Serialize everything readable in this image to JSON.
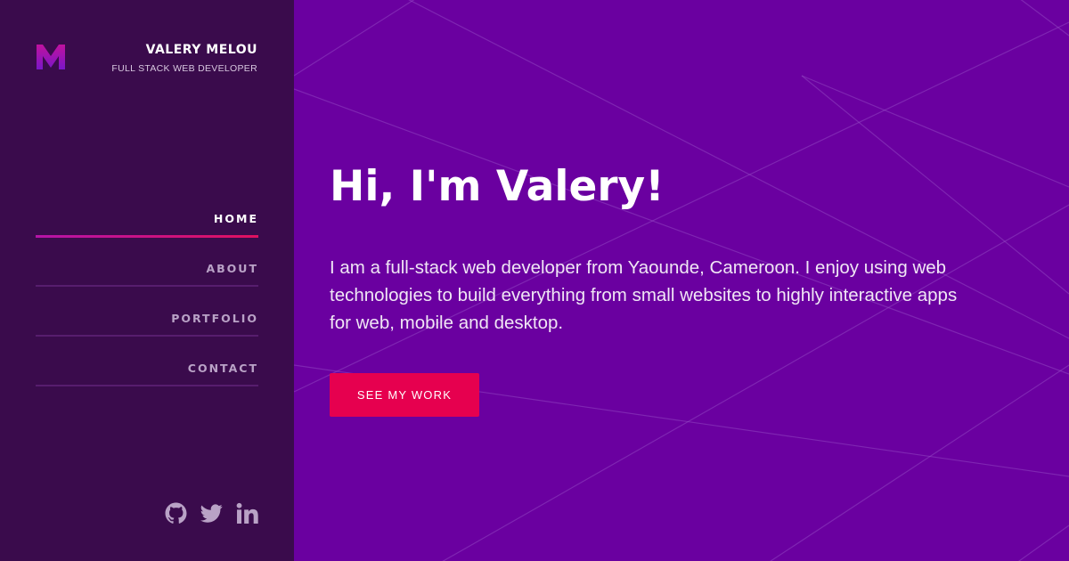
{
  "profile": {
    "name": "VALERY MELOU",
    "role": "FULL STACK WEB DEVELOPER",
    "logo_icon": "m-logo-icon"
  },
  "nav": {
    "items": [
      {
        "label": "HOME",
        "active": true
      },
      {
        "label": "ABOUT",
        "active": false
      },
      {
        "label": "PORTFOLIO",
        "active": false
      },
      {
        "label": "CONTACT",
        "active": false
      }
    ]
  },
  "social": {
    "icons": [
      "github-icon",
      "twitter-icon",
      "linkedin-icon"
    ]
  },
  "hero": {
    "title": "Hi, I'm Valery!",
    "intro": "I am a full-stack web developer from Yaounde, Cameroon. I enjoy using web technologies to build everything from small websites to highly interactive apps for web, mobile and desktop.",
    "cta_label": "SEE MY WORK"
  },
  "colors": {
    "sidebar_bg": "#3a0b4c",
    "main_bg": "#6a00a0",
    "accent": "#e6004f",
    "nav_active_gradient_start": "#b514a8"
  }
}
